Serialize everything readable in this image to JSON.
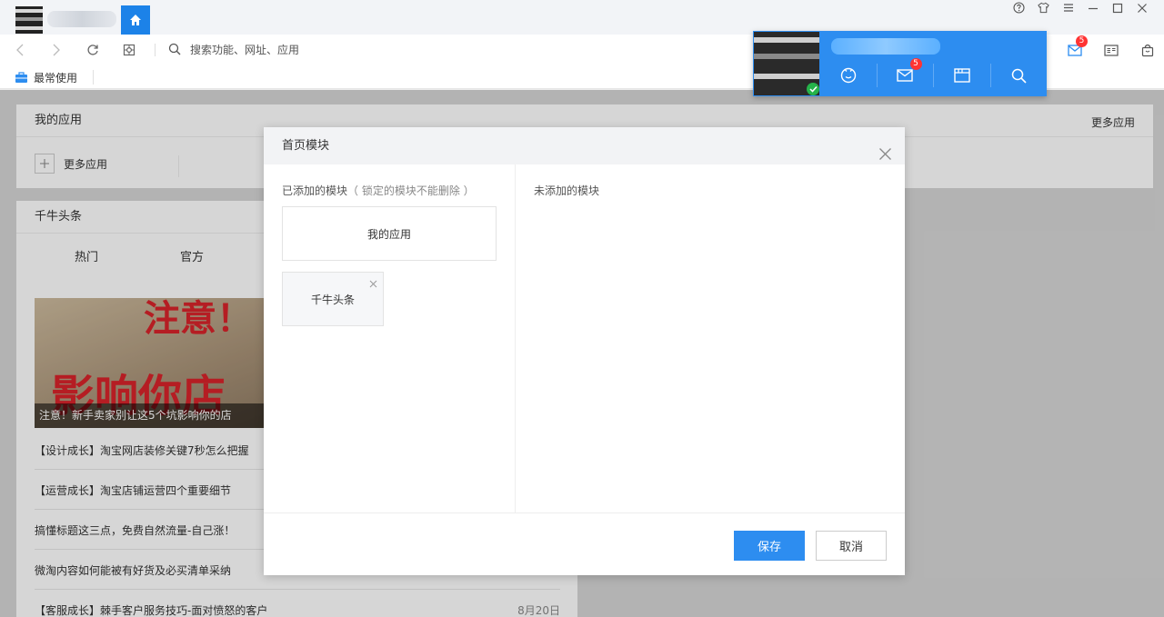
{
  "titlebar": {
    "home_icon": "home-icon",
    "controls": [
      "help-icon",
      "skin-icon",
      "menu-icon",
      "minimize-icon",
      "maximize-icon",
      "close-icon"
    ]
  },
  "navbar": {
    "search_placeholder": "搜索功能、网址、应用",
    "mail_badge": "5"
  },
  "bookmarks": {
    "item_label": "最常使用"
  },
  "user_popup": {
    "mail_badge": "5"
  },
  "background": {
    "my_apps": {
      "title": "我的应用",
      "more_link": "更多应用",
      "add_label": "更多应用"
    },
    "news": {
      "title": "千牛头条",
      "tabs": [
        "热门",
        "官方"
      ],
      "banner_caption": "注意！新手卖家别让这5个坑影响你的店",
      "banner_text_top": "注意！",
      "banner_text_bottom": "影响你店",
      "items": [
        {
          "text": "【设计成长】淘宝网店装修关键7秒怎么把握",
          "date": ""
        },
        {
          "text": "【运营成长】淘宝店铺运营四个重要细节",
          "date": ""
        },
        {
          "text": "搞懂标题这三点，免费自然流量-自己涨！",
          "date": ""
        },
        {
          "text": "微淘内容如何能被有好货及必买清单采纳",
          "date": ""
        },
        {
          "text": "【客服成长】棘手客户服务技巧-面对愤怒的客户",
          "date": "8月20日"
        }
      ]
    }
  },
  "modal": {
    "title": "首页模块",
    "added_title": "已添加的模块",
    "added_note": "（ 锁定的模块不能删除 ）",
    "not_added_title": "未添加的模块",
    "modules": [
      {
        "label": "我的应用",
        "locked": true
      },
      {
        "label": "千牛头条",
        "locked": false
      }
    ],
    "save_label": "保存",
    "cancel_label": "取消"
  },
  "colors": {
    "accent": "#2d8df0",
    "home_tab": "#1c82e8",
    "badge": "#ff3333"
  }
}
